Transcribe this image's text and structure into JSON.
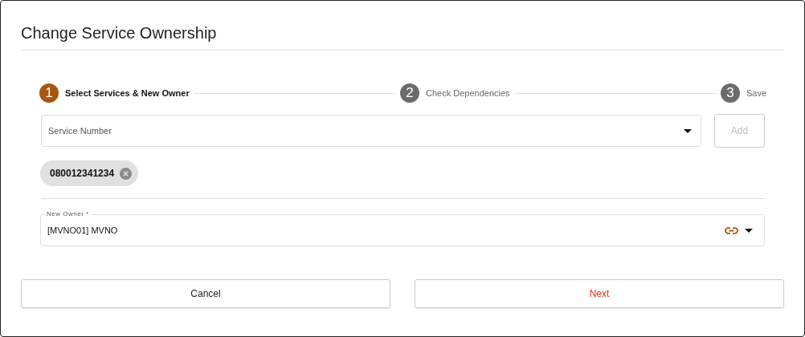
{
  "dialog": {
    "title": "Change Service Ownership"
  },
  "steps": [
    {
      "number": "1",
      "label": "Select Services & New Owner",
      "selected": true
    },
    {
      "number": "2",
      "label": "Check Dependencies",
      "selected": false
    },
    {
      "number": "3",
      "label": "Save",
      "selected": false
    }
  ],
  "service_field": {
    "placeholder": "Service Number"
  },
  "add_button": {
    "label": "Add",
    "disabled": true
  },
  "chips": [
    {
      "label": "080012341234"
    }
  ],
  "new_owner_field": {
    "label": "New Owner *",
    "value": "[MVNO01] MVNO"
  },
  "buttons": [
    {
      "label": "Cancel",
      "kind": "secondary"
    },
    {
      "label": "Next",
      "kind": "primary"
    }
  ]
}
